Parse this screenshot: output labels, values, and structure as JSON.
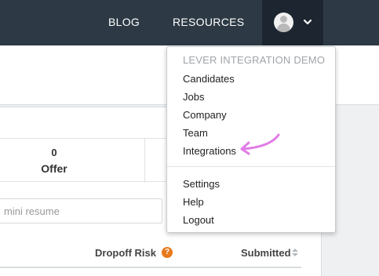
{
  "nav": {
    "blog": "BLOG",
    "resources": "RESOURCES"
  },
  "stage": {
    "count": "0",
    "label": "Offer"
  },
  "search": {
    "placeholder": "mini resume"
  },
  "table": {
    "columns": {
      "dropoff_risk": "Dropoff Risk",
      "submitted": "Submitted"
    },
    "help_icon_glyph": "?"
  },
  "menu": {
    "heading": "LEVER INTEGRATION DEMO",
    "items": [
      "Candidates",
      "Jobs",
      "Company",
      "Team",
      "Integrations"
    ],
    "footer_items": [
      "Settings",
      "Help",
      "Logout"
    ],
    "highlighted_item": "Integrations"
  },
  "colors": {
    "topbar": "#2d3a45",
    "account_toggle": "#1d2630",
    "help_icon": "#e8791c",
    "annotation_arrow": "#e17ce6"
  },
  "icons": [
    "avatar",
    "chevron-down-icon",
    "help-icon",
    "sort-icon",
    "arrow-pointer-icon"
  ]
}
